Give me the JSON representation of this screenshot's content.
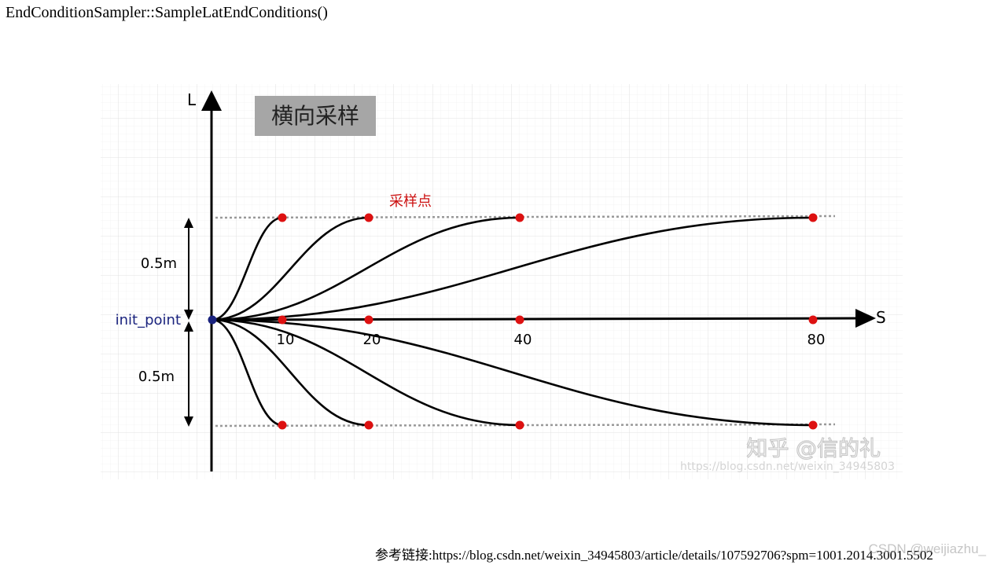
{
  "page": {
    "title": "EndConditionSampler::SampleLatEndConditions()",
    "reference": "参考链接:https://blog.csdn.net/weixin_34945803/article/details/107592706?spm=1001.2014.3001.5502",
    "corner_watermark": "CSDN @weijiazhu_"
  },
  "diagram": {
    "heading": "横向采样",
    "axis_l_label": "L",
    "axis_s_label": "S",
    "sample_points_label": "采样点",
    "origin_label": "init_point",
    "upper_offset_label": "0.5m",
    "lower_offset_label": "0.5m",
    "s_ticks": [
      "10",
      "20",
      "40",
      "80"
    ],
    "s_values": [
      10,
      20,
      40,
      80
    ],
    "l_values": [
      0.5,
      0,
      -0.5
    ],
    "watermark_brand": "知乎 @信的礼",
    "watermark_url": "https://blog.csdn.net/weixin_34945803",
    "colors": {
      "sample_point": "#dd1111",
      "origin_point": "#1a237e",
      "origin_label": "#1a237e",
      "sample_label": "#cc1111",
      "heading_bg": "#a6a6a6",
      "curve": "#000000",
      "bound_line": "#999999",
      "grid": "#e6e6e6"
    }
  }
}
